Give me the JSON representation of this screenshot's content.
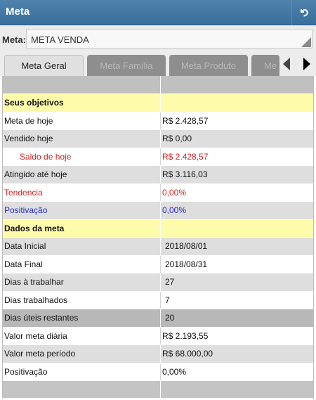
{
  "header": {
    "title": "Meta"
  },
  "meta_selector": {
    "label": "Meta:",
    "value": "META VENDA"
  },
  "tabs": [
    {
      "label": "Meta Geral"
    },
    {
      "label": "Meta Família"
    },
    {
      "label": "Meta Produto"
    },
    {
      "label": "Me"
    }
  ],
  "rows": [
    {
      "label": "Seus objetivos",
      "value": ""
    },
    {
      "label": "Meta de hoje",
      "value": "R$ 2.428,57"
    },
    {
      "label": "Vendido hoje",
      "value": "R$ 0,00"
    },
    {
      "label": "Saldo de hoje",
      "value": "R$ 2.428,57"
    },
    {
      "label": "Atingido até hoje",
      "value": "R$ 3.116,03"
    },
    {
      "label": "Tendencia",
      "value": "0,00%"
    },
    {
      "label": "Positivação",
      "value": "0,00%"
    },
    {
      "label": "Dados da meta",
      "value": ""
    },
    {
      "label": "Data Inicial",
      "value": "2018/08/01"
    },
    {
      "label": "Data Final",
      "value": "2018/08/31"
    },
    {
      "label": "Dias à trabalhar",
      "value": "27"
    },
    {
      "label": "Dias trabalhados",
      "value": "7"
    },
    {
      "label": "Dias úteis restantes",
      "value": "20"
    },
    {
      "label": "Valor meta diária",
      "value": "R$ 2.193,55"
    },
    {
      "label": "Valor meta período",
      "value": "R$ 68.000,00"
    },
    {
      "label": "Positivação",
      "value": "0,00%"
    }
  ],
  "colors": {
    "titlebar": "#3f76a2",
    "highlight_row": "#fefcaa",
    "negative": "#d32323",
    "positivacao": "#2a2ad0"
  },
  "icons": {
    "back": "undo-arrow-icon",
    "scroll_left": "triangle-left-icon",
    "scroll_right": "triangle-right-icon"
  }
}
